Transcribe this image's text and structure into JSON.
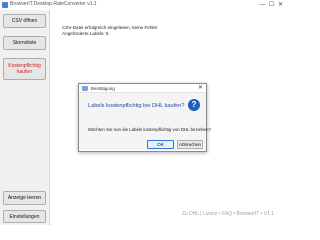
{
  "window": {
    "title": "BrowserIT.Desktop.RateConverter v1.1",
    "minimize": "—",
    "maximize": "☐",
    "close": "✕"
  },
  "sidebar": {
    "csv_open": "CSV öffnen",
    "storno": "Stornoliste",
    "buy_label_line1": "Kostenpflichtig",
    "buy_label_line2": "kaufen",
    "clear_display": "Anzeige leeren",
    "settings": "Einstellungen"
  },
  "colors": {
    "buy_button_text": "#d41f1f",
    "dialog_heading": "#1d4fa0",
    "question_icon": "#1f5fbf"
  },
  "content": {
    "status_line1": "CSV-Datei erfolgreich eingelesen, keine Fehler",
    "status_line2": "Angeforderte Labels: 6"
  },
  "statusbar": {
    "text": "Zu DHL  |  Lizenz • FAQ • BrowserIT • V1.1"
  },
  "dialog": {
    "title": "Bestätigung",
    "heading": "Labels kostenpflichtig bei DHL kaufen?",
    "message": "Möchten Sie nun die Labels kostenpflichtig von DHL beziehen?",
    "ok_label": "OK",
    "cancel_label": "Abbrechen",
    "icon_glyph": "?",
    "close_glyph": "✕"
  }
}
